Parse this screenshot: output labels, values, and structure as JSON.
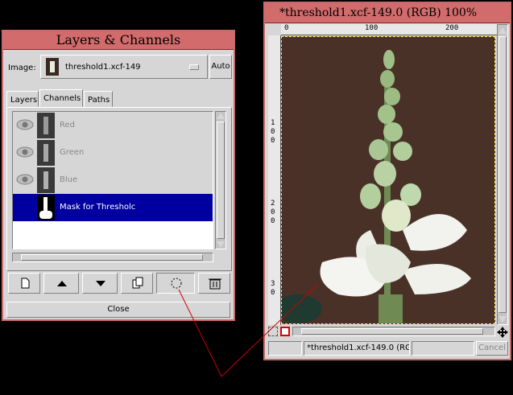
{
  "layers_dialog": {
    "title": "Layers & Channels",
    "image_label": "Image:",
    "image_value": "threshold1.xcf-149",
    "auto_label": "Auto",
    "tabs": [
      "Layers",
      "Channels",
      "Paths"
    ],
    "active_tab": "Channels",
    "channels": [
      {
        "name": "Red"
      },
      {
        "name": "Green"
      },
      {
        "name": "Blue"
      },
      {
        "name": "Mask for Thresholc"
      }
    ],
    "close_label": "Close"
  },
  "image_window": {
    "title": "*threshold1.xcf-149.0 (RGB) 100%",
    "ruler_top": [
      "0",
      "100",
      "200"
    ],
    "ruler_left": [
      "1 0 0",
      "2 0 0",
      "3 0"
    ],
    "status_text": "*threshold1.xcf-149.0 (RG",
    "cancel_label": "Cancel"
  },
  "colors": {
    "title_bar": "#d26b6b",
    "selection": "#0000a0",
    "annotation_line": "#cc0000"
  }
}
